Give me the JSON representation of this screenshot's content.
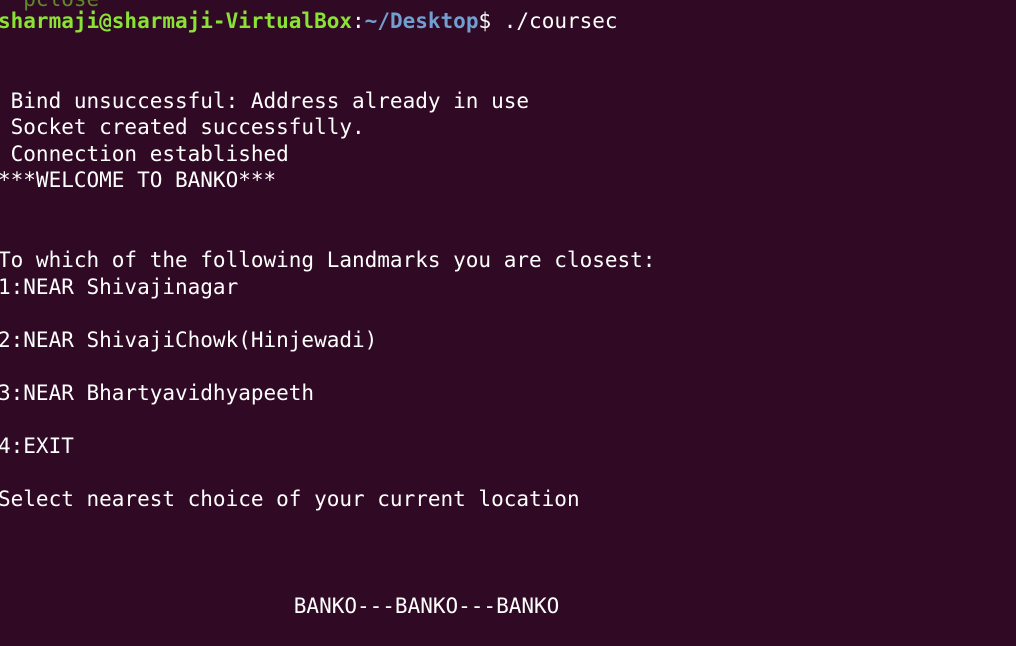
{
  "terminal": {
    "partial_top": "  pclose",
    "prompt": {
      "user_host": "sharmaji@sharmaji-VirtualBox",
      "colon": ":",
      "path": "~/Desktop",
      "symbol": "$ ",
      "command": "./coursec"
    },
    "output": [
      " Bind unsuccessful: Address already in use",
      " Socket created successfully.",
      " Connection established",
      "***WELCOME TO BANKO***",
      "To which of the following Landmarks you are closest:",
      "1:NEAR Shivajinagar",
      "2:NEAR ShivajiChowk(Hinjewadi)",
      "3:NEAR Bhartyavidhyapeeth",
      "4:EXIT",
      "Select nearest choice of your current location",
      "                       BANKO---BANKO---BANKO"
    ],
    "colors": {
      "background": "#300a24",
      "text": "#ffffff",
      "user": "#8ae234",
      "path": "#729fcf"
    }
  }
}
